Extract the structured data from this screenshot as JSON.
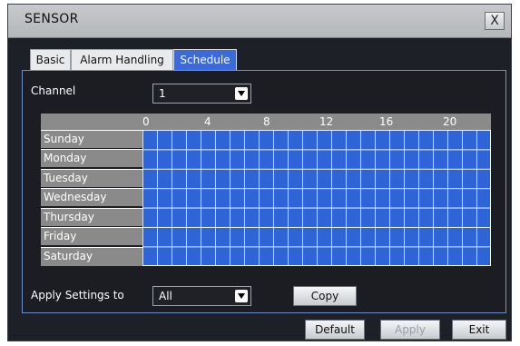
{
  "window": {
    "title": "SENSOR",
    "close_label": "X"
  },
  "tabs": [
    {
      "label": "Basic",
      "active": false
    },
    {
      "label": "Alarm Handling",
      "active": false
    },
    {
      "label": "Schedule",
      "active": true
    }
  ],
  "channel": {
    "label": "Channel",
    "value": "1"
  },
  "schedule": {
    "hours": [
      "0",
      "4",
      "8",
      "12",
      "16",
      "20"
    ],
    "days": [
      "Sunday",
      "Monday",
      "Tuesday",
      "Wednesday",
      "Thursday",
      "Friday",
      "Saturday"
    ],
    "all_scheduled": true,
    "cell_color": "#2f64d6"
  },
  "apply_settings": {
    "label": "Apply Settings to",
    "value": "All",
    "copy_label": "Copy"
  },
  "footer": {
    "default_label": "Default",
    "apply_label": "Apply",
    "exit_label": "Exit"
  },
  "colors": {
    "accent": "#3c6ad8",
    "panel_border": "#6b8fd0",
    "background": "#1b1d22"
  }
}
